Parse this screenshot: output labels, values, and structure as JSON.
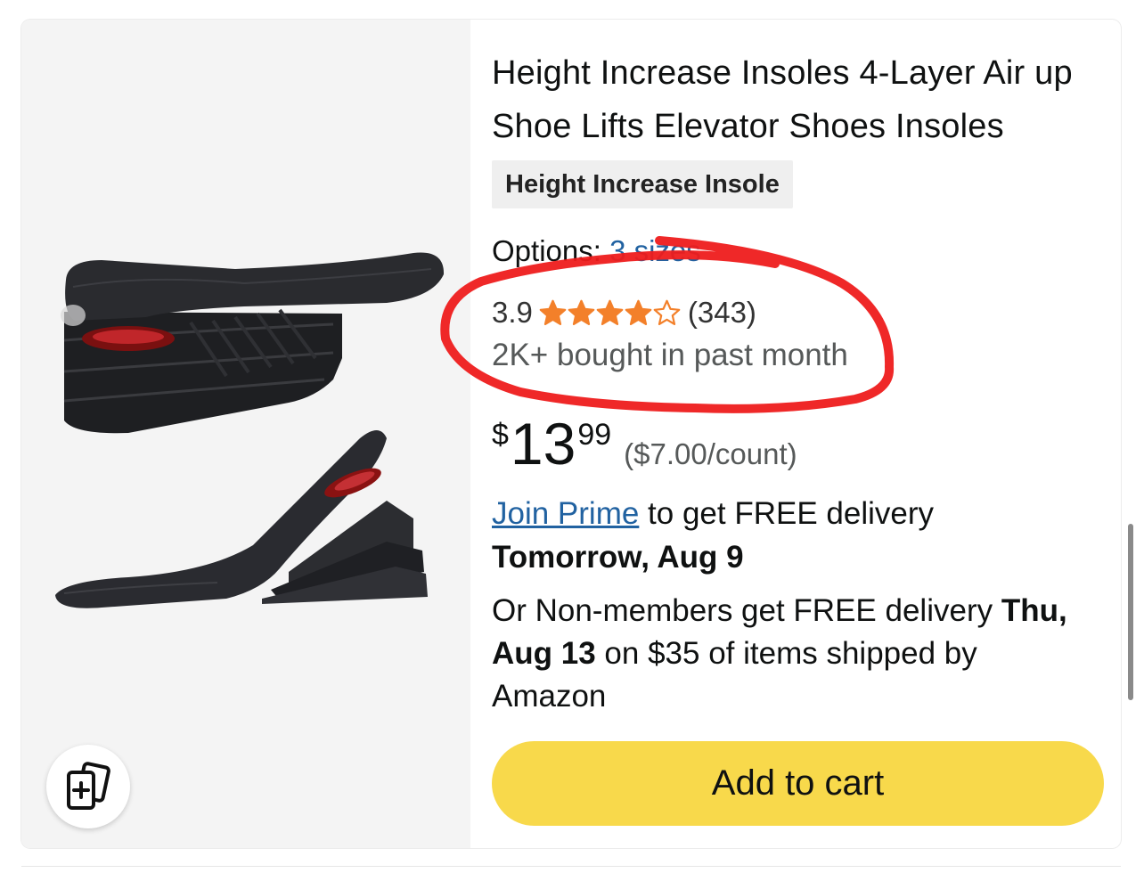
{
  "product": {
    "title": "Height Increase Insoles 4-Layer Air up Shoe Lifts Elevator Shoes Insoles",
    "badge": "Height Increase Insole",
    "options_label": "Options:",
    "options_link": "3 sizes",
    "rating_value": "3.9",
    "rating_stars": 3.9,
    "rating_max": 5,
    "review_count": "(343)",
    "bought_text": "2K+ bought in past month",
    "price": {
      "symbol": "$",
      "whole": "13",
      "fraction": "99",
      "unit_price": "($7.00/count)"
    },
    "delivery": {
      "prime_link": "Join Prime",
      "prime_text": " to get FREE delivery",
      "prime_date": "Tomorrow, Aug 9",
      "nonmember_prefix": "Or Non-members get FREE delivery ",
      "nonmember_date": "Thu, Aug 13",
      "nonmember_suffix": " on $35 of items shipped by Amazon"
    },
    "add_to_cart_label": "Add to cart"
  },
  "icons": {
    "compare": "compare-cards-icon",
    "star": "star-icon"
  },
  "colors": {
    "star": "#f3802a",
    "link": "#2162a1",
    "cart_button": "#f8d94b",
    "annotation": "#ee1c1c",
    "image_background": "#f4f4f4"
  }
}
